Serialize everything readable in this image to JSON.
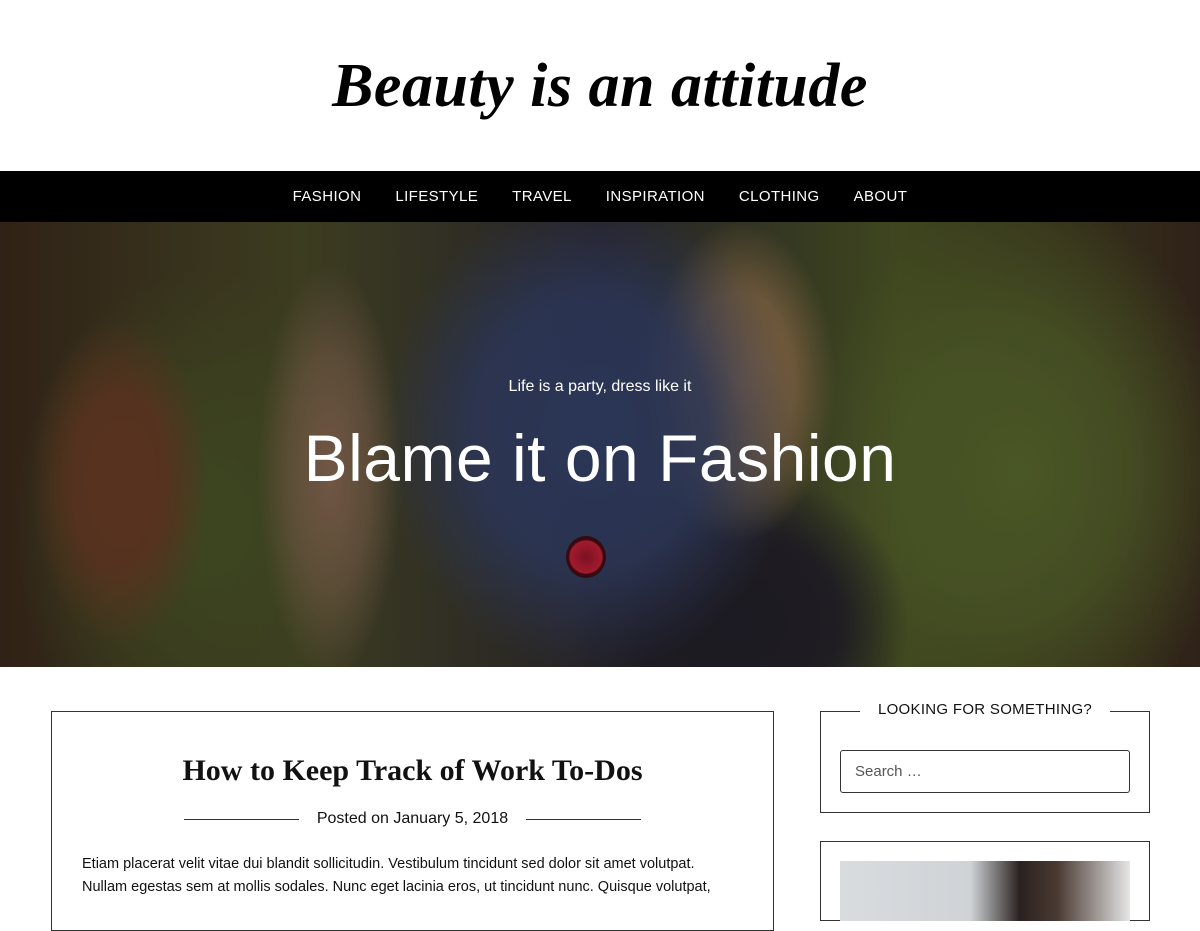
{
  "site": {
    "title": "Beauty is an attitude"
  },
  "nav": {
    "items": [
      {
        "label": "FASHION"
      },
      {
        "label": "LIFESTYLE"
      },
      {
        "label": "TRAVEL"
      },
      {
        "label": "INSPIRATION"
      },
      {
        "label": "CLOTHING"
      },
      {
        "label": "ABOUT"
      }
    ]
  },
  "hero": {
    "subtitle": "Life is a party, dress like it",
    "title": "Blame it on Fashion"
  },
  "post": {
    "title": "How to Keep Track of Work To-Dos",
    "meta_prefix": "Posted on",
    "date": "January 5, 2018",
    "excerpt_line1": "Etiam placerat velit vitae dui blandit sollicitudin. Vestibulum tincidunt sed dolor sit amet volutpat.",
    "excerpt_line2": "Nullam egestas sem at mollis sodales. Nunc eget lacinia eros, ut tincidunt nunc. Quisque volutpat,"
  },
  "sidebar": {
    "search_widget": {
      "title": "LOOKING FOR SOMETHING?",
      "placeholder": "Search …"
    }
  },
  "colors": {
    "nav_background": "#000000",
    "page_background": "#ffffff",
    "text": "#111111"
  }
}
